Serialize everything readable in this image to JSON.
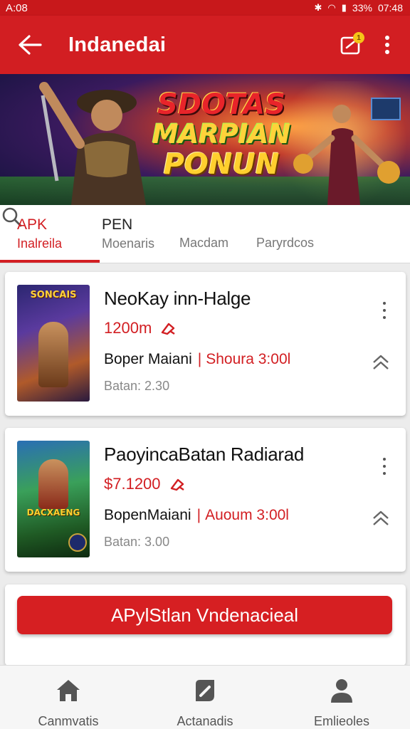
{
  "status_bar": {
    "time": "A:08",
    "battery": "33%",
    "clock": "07:48"
  },
  "app_bar": {
    "title": "Indanedai",
    "notification_count": "1",
    "colors": {
      "primary": "#d21e22"
    }
  },
  "banner": {
    "line1": "SDOTAS",
    "line2": "MARPIAN",
    "line3": "PONUN"
  },
  "tabs": [
    {
      "label": "APK",
      "sublabel": "Inalreila",
      "active": true
    },
    {
      "label": "PEN",
      "sublabel": "Moenaris",
      "active": false
    },
    {
      "label": "Macdam",
      "active": false
    },
    {
      "label": "Paryrdcos",
      "active": false
    }
  ],
  "cards": [
    {
      "title": "NeoKay inn-Halge",
      "price": "1200m",
      "developer": "Boper Maiani",
      "extra": "Shoura 3:00l",
      "meta": "Batan: 2.30",
      "thumb_title": "SONCAIS"
    },
    {
      "title": "PaoyincaBatan Radiarad",
      "price": "$7.1200",
      "developer": "BopenMaiani",
      "extra": "Auoum 3:00l",
      "meta": "Batan: 3.00",
      "thumb_title": "DACXAENG"
    }
  ],
  "cta": {
    "label": "APylStlan Vndenacieal"
  },
  "bottom_nav": [
    {
      "label": "Canmvatis",
      "icon": "home-icon"
    },
    {
      "label": "Actanadis",
      "icon": "edit-icon"
    },
    {
      "label": "Emlieoles",
      "icon": "person-icon"
    }
  ]
}
